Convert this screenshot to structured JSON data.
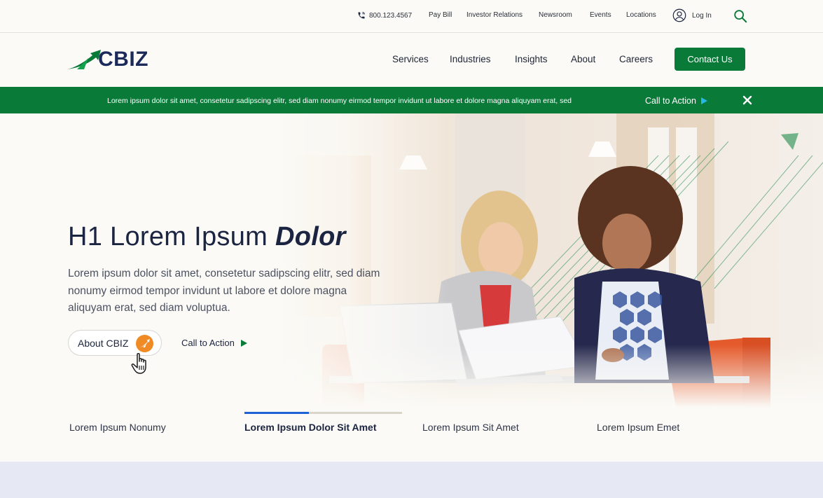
{
  "utility": {
    "phone": "800.123.4567",
    "links": [
      "Pay Bill",
      "Investor Relations",
      "Newsroom",
      "Events",
      "Locations"
    ],
    "login": "Log In",
    "search_icon": "search-icon"
  },
  "brand": {
    "logo_text": "CBIZ",
    "color": "#0a7a39"
  },
  "nav": {
    "items": [
      "Services",
      "Industries",
      "Insights",
      "About",
      "Careers"
    ],
    "contact": "Contact Us"
  },
  "announcement": {
    "message": "Lorem ipsum dolor sit amet, consetetur sadipscing elitr, sed diam nonumy eirmod tempor invidunt ut labore et dolore magna aliquyam erat, sed",
    "cta": "Call to Action",
    "close_icon": "close-icon"
  },
  "hero": {
    "title_main": "H1 Lorem Ipsum ",
    "title_emphasis": "Dolor",
    "lead": "Lorem ipsum dolor sit amet, consetetur sadipscing elitr, sed diam nonumy eirmod tempor invidunt ut labore et dolore magna aliquyam erat, sed diam voluptua.",
    "primary_button": "About CBIZ",
    "secondary_cta": "Call to Action"
  },
  "tabs": {
    "items": [
      "Lorem Ipsum Nonumy",
      "Lorem Ipsum Dolor Sit Amet",
      "Lorem Ipsum Sit Amet",
      "Lorem Ipsum Emet"
    ],
    "active_index": 1,
    "active_progress_percent": 41
  },
  "colors": {
    "green": "#0a7a39",
    "orange": "#f08a24",
    "blue": "#1e62d8",
    "cta_arrow": "#29b6e8"
  }
}
